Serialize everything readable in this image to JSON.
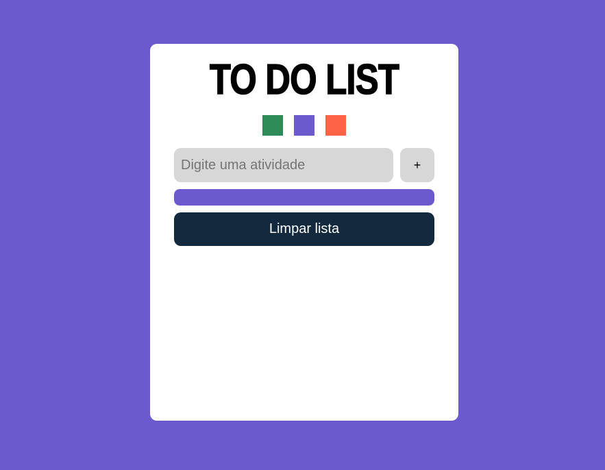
{
  "app": {
    "title": "TO DO LIST"
  },
  "theme": {
    "page_background": "#6a5acd",
    "card_background": "#ffffff",
    "input_background": "#d7d7d7",
    "clear_button_background": "#13293d",
    "progress_color": "#6a5acd"
  },
  "color_picker": {
    "options": [
      {
        "name": "green",
        "color": "#2e8b57"
      },
      {
        "name": "purple",
        "color": "#6a5acd"
      },
      {
        "name": "orange",
        "color": "#ff6347"
      }
    ]
  },
  "task_form": {
    "input_value": "",
    "input_placeholder": "Digite uma atividade",
    "add_label": "+"
  },
  "progress": {
    "value": 1.0
  },
  "clear_button": {
    "label": "Limpar lista"
  },
  "tasks": []
}
